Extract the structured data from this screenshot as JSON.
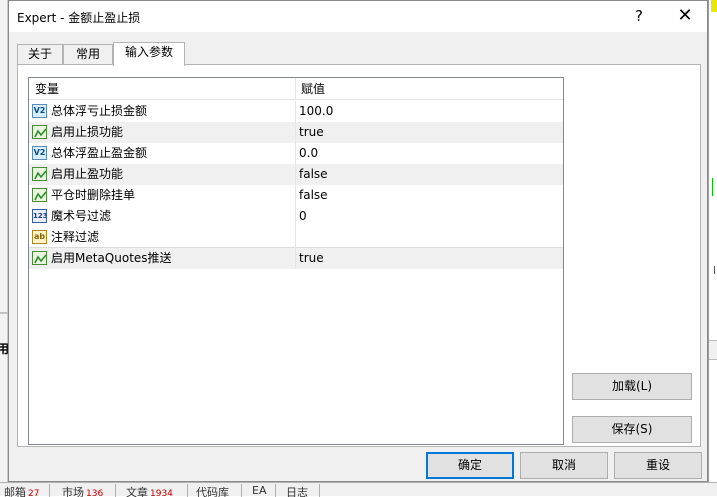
{
  "window": {
    "title": "Expert - 金额止盈止损",
    "help_glyph": "?",
    "close_glyph": "✕"
  },
  "tabs": [
    {
      "label": "关于",
      "active": false
    },
    {
      "label": "常用",
      "active": false
    },
    {
      "label": "输入参数",
      "active": true
    }
  ],
  "table": {
    "headers": {
      "variable": "变量",
      "value": "赋值"
    },
    "rows": [
      {
        "name": "总体浮亏止损金额",
        "value": "100.0",
        "type_icon": "double-type-icon",
        "icon_text": "V2"
      },
      {
        "name": "启用止损功能",
        "value": "true",
        "type_icon": "bool-type-icon",
        "icon_text": ""
      },
      {
        "name": "总体浮盈止盈金额",
        "value": "0.0",
        "type_icon": "double-type-icon",
        "icon_text": "V2"
      },
      {
        "name": "启用止盈功能",
        "value": "false",
        "type_icon": "bool-type-icon",
        "icon_text": ""
      },
      {
        "name": "平仓时删除挂单",
        "value": "false",
        "type_icon": "bool-type-icon",
        "icon_text": ""
      },
      {
        "name": "魔术号过滤",
        "value": "0",
        "type_icon": "int-type-icon",
        "icon_text": "123"
      },
      {
        "name": "注释过滤",
        "value": "",
        "type_icon": "string-type-icon",
        "icon_text": "ab"
      },
      {
        "name": "启用MetaQuotes推送",
        "value": "true",
        "type_icon": "bool-type-icon",
        "icon_text": ""
      }
    ]
  },
  "buttons": {
    "load": "加载(L)",
    "save": "保存(S)",
    "ok": "确定",
    "cancel": "取消",
    "reset": "重设"
  },
  "background": {
    "left_char": "用",
    "bottom_tabs": [
      {
        "label": "邮箱",
        "count": "27"
      },
      {
        "label": "市场",
        "count": "136"
      },
      {
        "label": "文章",
        "count": "1934"
      },
      {
        "label": "代码库",
        "count": ""
      },
      {
        "label": "EA",
        "count": ""
      },
      {
        "label": "日志",
        "count": ""
      }
    ]
  },
  "colors": {
    "default_button_border": "#0078d7",
    "alt_row": "#f0f0f0",
    "dialog_bg": "#f0f0f0",
    "bool_icon_green": "#2e8b2e"
  }
}
